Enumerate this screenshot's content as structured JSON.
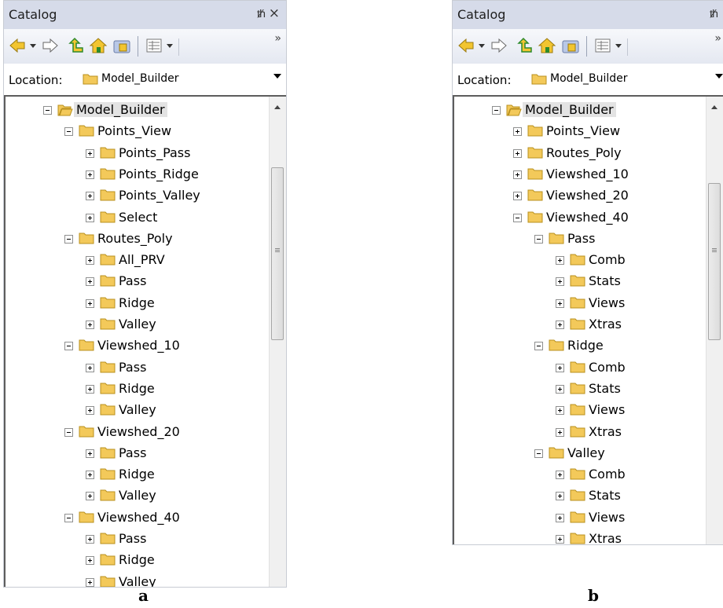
{
  "panels": {
    "a": {
      "title": "Catalog",
      "pin": "A",
      "close": "×",
      "overflow": "»",
      "location_label": "Location:",
      "location_value": "Model_Builder",
      "caption": "a",
      "root": "Model_Builder",
      "groups": [
        {
          "label": "Points_View",
          "expanded": true,
          "children": [
            "Points_Pass",
            "Points_Ridge",
            "Points_Valley",
            "Select"
          ]
        },
        {
          "label": "Routes_Poly",
          "expanded": true,
          "children": [
            "All_PRV",
            "Pass",
            "Ridge",
            "Valley"
          ]
        },
        {
          "label": "Viewshed_10",
          "expanded": true,
          "children": [
            "Pass",
            "Ridge",
            "Valley"
          ]
        },
        {
          "label": "Viewshed_20",
          "expanded": true,
          "children": [
            "Pass",
            "Ridge",
            "Valley"
          ]
        },
        {
          "label": "Viewshed_40",
          "expanded": true,
          "children": [
            "Pass",
            "Ridge",
            "Valley"
          ]
        }
      ]
    },
    "b": {
      "title": "Catalog",
      "pin": "A",
      "close": "×",
      "overflow": "»",
      "location_label": "Location:",
      "location_value": "Model_Builder",
      "caption": "b",
      "root": "Model_Builder",
      "groups": [
        {
          "label": "Points_View",
          "expanded": false
        },
        {
          "label": "Routes_Poly",
          "expanded": false
        },
        {
          "label": "Viewshed_10",
          "expanded": false
        },
        {
          "label": "Viewshed_20",
          "expanded": false
        },
        {
          "label": "Viewshed_40",
          "expanded": true,
          "subgroups": [
            {
              "label": "Pass",
              "children": [
                "Comb",
                "Stats",
                "Views",
                "Xtras"
              ]
            },
            {
              "label": "Ridge",
              "children": [
                "Comb",
                "Stats",
                "Views",
                "Xtras"
              ]
            },
            {
              "label": "Valley",
              "children": [
                "Comb",
                "Stats",
                "Views",
                "Xtras"
              ]
            }
          ]
        }
      ]
    }
  },
  "icons": {
    "back": "back-arrow-icon",
    "forward": "forward-arrow-icon",
    "up": "up-one-level-icon",
    "home": "home-folder-icon",
    "connect": "connect-folder-icon",
    "views": "view-options-icon"
  },
  "colors": {
    "titlebar": "#d6dbe9",
    "folder": "#f3c95a",
    "arrows": "#2c8a2c"
  }
}
